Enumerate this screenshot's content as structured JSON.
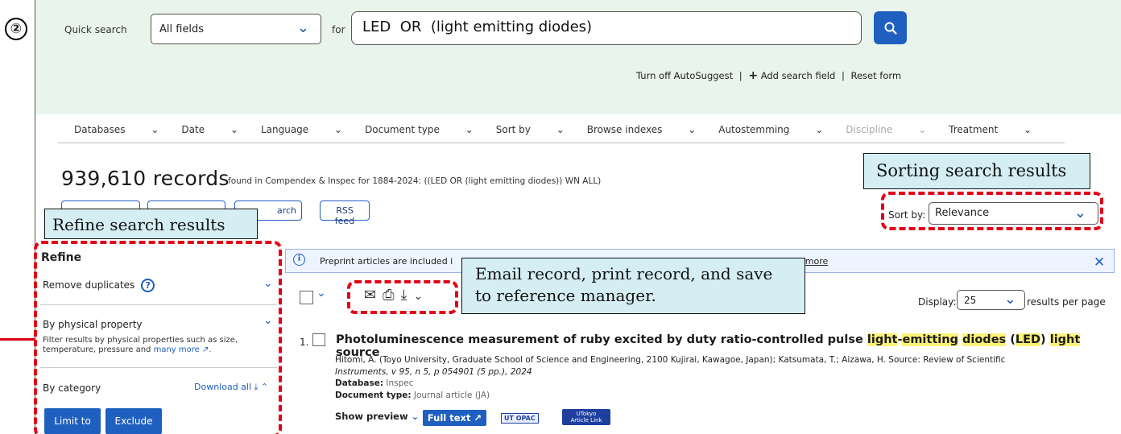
{
  "step_marker": "②",
  "search": {
    "quick_search_label": "Quick search",
    "field_select": "All fields",
    "for_label": "for",
    "query": "LED  OR  (light emitting diodes)",
    "links": [
      "Turn off AutoSuggest",
      "Add search field",
      "Reset form"
    ],
    "separators": [
      "|",
      "|"
    ],
    "add_icon": "+"
  },
  "filters": [
    "Databases",
    "Date",
    "Language",
    "Document type",
    "Sort by",
    "Browse indexes",
    "Autostemming",
    "Discipline",
    "Treatment"
  ],
  "results": {
    "count": "939,610 records",
    "found_text": "found in Compendex & Inspec for 1884-2024: ((LED OR (light emitting diodes)) WN ALL)",
    "buttons": [
      "arch",
      "RSS feed"
    ],
    "sort_label": "Sort by:",
    "sort_value": "Relevance"
  },
  "callouts": {
    "sorting": "Sorting search results",
    "refine": "Refine search results",
    "email": "Email record, print record, and save\nto reference manager."
  },
  "refine": {
    "title": "Refine",
    "remove_duplicates": "Remove duplicates",
    "physical_property": "By physical property",
    "physical_desc": "Filter results by physical properties such as size, temperature, pressure and",
    "many_more": "many more",
    "by_category": "By category",
    "download_all": "Download all",
    "limit_to": "Limit to",
    "exclude": "Exclude"
  },
  "banner": {
    "text": "Preprint articles are included i",
    "learn_more": "rn more"
  },
  "toolbar": {
    "display_label": "Display:",
    "display_value": "25",
    "per_page": "results per page"
  },
  "record": {
    "number": "1.",
    "title_parts": [
      "Photoluminescence measurement of ruby excited by duty ratio-controlled pulse ",
      "light",
      "-",
      "emitting",
      " ",
      "diodes",
      " (",
      "LED",
      ") ",
      "light",
      " source"
    ],
    "authors_line1": "Hitomi, A. (Toyo University, Graduate School of Science and Engineering, 2100 Kujirai, Kawagoe, Japan); Katsumata, T.; Aizawa, H. Source: Review of Scientific",
    "authors_line2": "Instruments, v 95, n 5, p 054901 (5 pp.), 2024",
    "database_label": "Database:",
    "database_value": "Inspec",
    "doctype_label": "Document type:",
    "doctype_value": "Journal article (JA)",
    "show_preview": "Show preview",
    "full_text": "Full text",
    "ut_opac": "UT OPAC",
    "utokyo_link_1": "UTokyo",
    "utokyo_link_2": "Article Link"
  },
  "colors": {
    "accent": "#1f5fbf",
    "band": "#e8f4ec",
    "callout": "#d4eef4",
    "dashed": "#e00018",
    "highlight": "#fbf37a"
  }
}
